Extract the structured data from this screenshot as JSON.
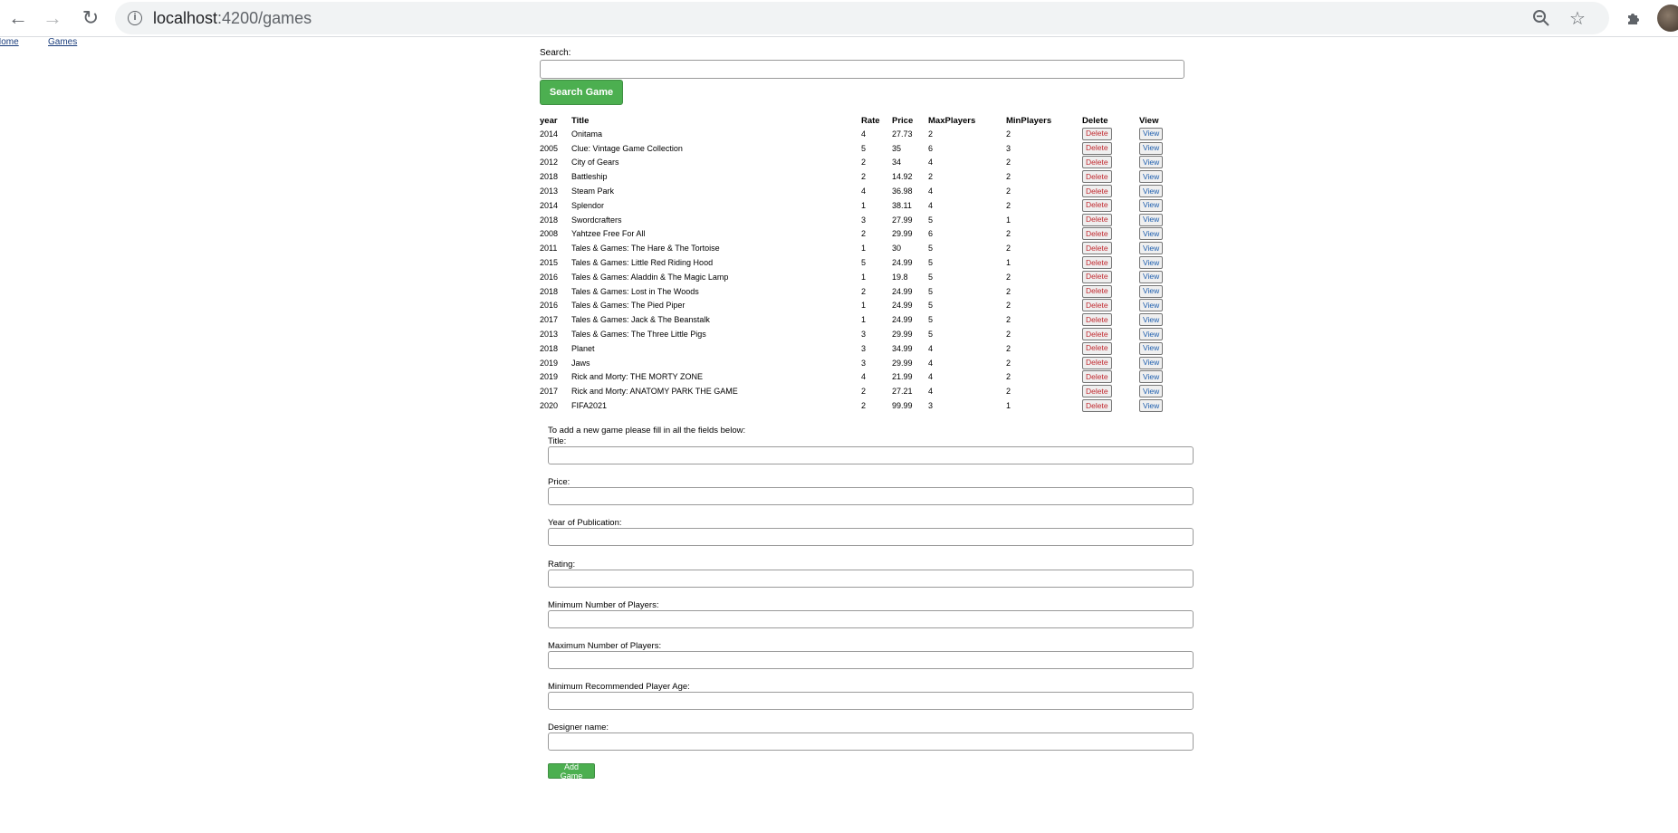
{
  "browser": {
    "url_host": "localhost",
    "url_path": ":4200/games"
  },
  "nav": {
    "home_label": "Home",
    "games_label": "Games"
  },
  "search": {
    "label": "Search:",
    "value": "",
    "button_label": "Search Game"
  },
  "table": {
    "headers": [
      "year",
      "Title",
      "Rate",
      "Price",
      "MaxPlayers",
      "MinPlayers",
      "Delete",
      "View"
    ],
    "delete_label": "Delete",
    "view_label": "View",
    "rows": [
      {
        "year": "2014",
        "title": "Onitama",
        "rate": "4",
        "price": "27.73",
        "max": "2",
        "min": "2"
      },
      {
        "year": "2005",
        "title": "Clue: Vintage Game Collection",
        "rate": "5",
        "price": "35",
        "max": "6",
        "min": "3"
      },
      {
        "year": "2012",
        "title": "City of Gears",
        "rate": "2",
        "price": "34",
        "max": "4",
        "min": "2"
      },
      {
        "year": "2018",
        "title": "Battleship",
        "rate": "2",
        "price": "14.92",
        "max": "2",
        "min": "2"
      },
      {
        "year": "2013",
        "title": "Steam Park",
        "rate": "4",
        "price": "36.98",
        "max": "4",
        "min": "2"
      },
      {
        "year": "2014",
        "title": "Splendor",
        "rate": "1",
        "price": "38.11",
        "max": "4",
        "min": "2"
      },
      {
        "year": "2018",
        "title": "Swordcrafters",
        "rate": "3",
        "price": "27.99",
        "max": "5",
        "min": "1"
      },
      {
        "year": "2008",
        "title": "Yahtzee Free For All",
        "rate": "2",
        "price": "29.99",
        "max": "6",
        "min": "2"
      },
      {
        "year": "2011",
        "title": "Tales & Games: The Hare & The Tortoise",
        "rate": "1",
        "price": "30",
        "max": "5",
        "min": "2"
      },
      {
        "year": "2015",
        "title": "Tales & Games: Little Red Riding Hood",
        "rate": "5",
        "price": "24.99",
        "max": "5",
        "min": "1"
      },
      {
        "year": "2016",
        "title": "Tales & Games: Aladdin & The Magic Lamp",
        "rate": "1",
        "price": "19.8",
        "max": "5",
        "min": "2"
      },
      {
        "year": "2018",
        "title": "Tales & Games: Lost in The Woods",
        "rate": "2",
        "price": "24.99",
        "max": "5",
        "min": "2"
      },
      {
        "year": "2016",
        "title": "Tales & Games: The Pied Piper",
        "rate": "1",
        "price": "24.99",
        "max": "5",
        "min": "2"
      },
      {
        "year": "2017",
        "title": "Tales & Games: Jack & The Beanstalk",
        "rate": "1",
        "price": "24.99",
        "max": "5",
        "min": "2"
      },
      {
        "year": "2013",
        "title": "Tales & Games: The Three Little Pigs",
        "rate": "3",
        "price": "29.99",
        "max": "5",
        "min": "2"
      },
      {
        "year": "2018",
        "title": "Planet",
        "rate": "3",
        "price": "34.99",
        "max": "4",
        "min": "2"
      },
      {
        "year": "2019",
        "title": "Jaws",
        "rate": "3",
        "price": "29.99",
        "max": "4",
        "min": "2"
      },
      {
        "year": "2019",
        "title": "Rick and Morty: THE MORTY ZONE",
        "rate": "4",
        "price": "21.99",
        "max": "4",
        "min": "2"
      },
      {
        "year": "2017",
        "title": "Rick and Morty: ANATOMY PARK THE GAME",
        "rate": "2",
        "price": "27.21",
        "max": "4",
        "min": "2"
      },
      {
        "year": "2020",
        "title": "FIFA2021",
        "rate": "2",
        "price": "99.99",
        "max": "3",
        "min": "1"
      }
    ]
  },
  "add_form": {
    "intro": "To add a new game please fill in all the fields below:",
    "fields": [
      {
        "label": "Title:",
        "value": ""
      },
      {
        "label": "Price:",
        "value": ""
      },
      {
        "label": "Year of Publication:",
        "value": ""
      },
      {
        "label": "Rating:",
        "value": ""
      },
      {
        "label": "Minimum Number of Players:",
        "value": ""
      },
      {
        "label": "Maximum Number of Players:",
        "value": ""
      },
      {
        "label": "Minimum Recommended Player Age:",
        "value": ""
      },
      {
        "label": "Designer name:",
        "value": ""
      }
    ],
    "button_label": "Add Game"
  },
  "icons": {
    "back": "back-arrow-icon",
    "forward": "forward-arrow-icon",
    "reload": "reload-icon",
    "info": "info-icon",
    "zoom": "zoom-out-icon",
    "star": "star-icon",
    "extensions": "puzzle-piece-icon"
  },
  "colors": {
    "accent_green": "#4caf50",
    "delete_red": "#c0272d",
    "view_blue": "#1f5fae",
    "link_blue": "#1a3d7c"
  }
}
